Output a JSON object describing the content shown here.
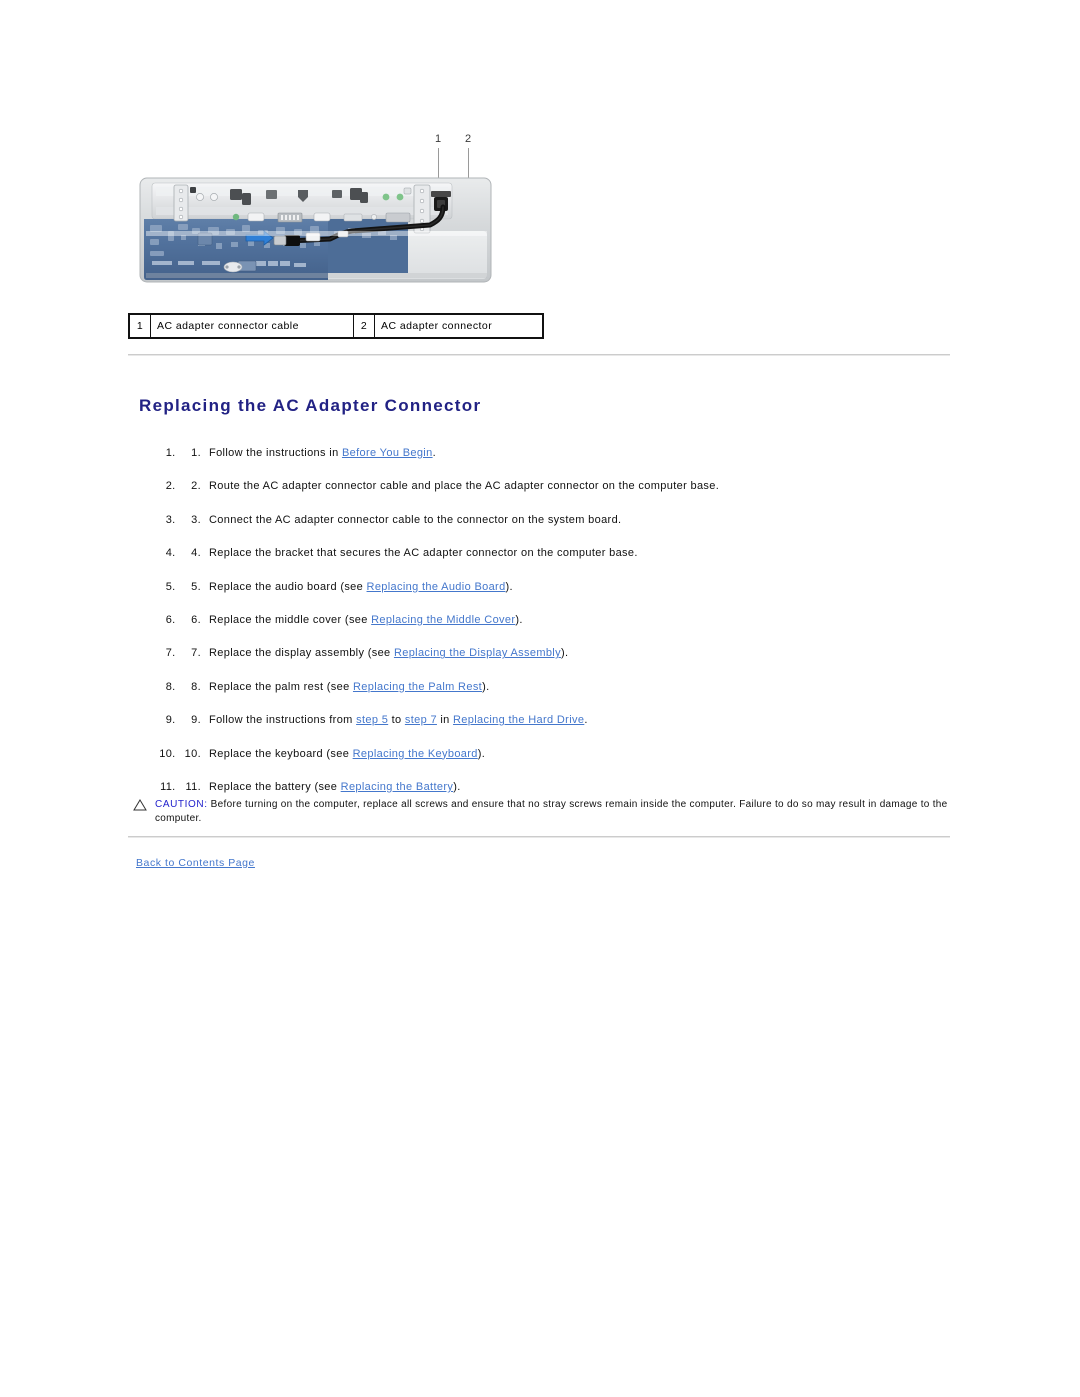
{
  "figure": {
    "alt": "Laptop computer base with system board and AC adapter connector cable routing",
    "callouts": [
      {
        "num": "1",
        "label": "AC adapter connector cable"
      },
      {
        "num": "2",
        "label": "AC adapter connector"
      }
    ]
  },
  "legend": {
    "rows": [
      {
        "num": "1",
        "label": "AC adapter connector cable"
      },
      {
        "num": "2",
        "label": "AC adapter connector"
      }
    ]
  },
  "heading": "Replacing the AC Adapter Connector",
  "steps": [
    {
      "marker": "1.",
      "parts": [
        {
          "t": "text",
          "v": "Follow the instructions in "
        },
        {
          "t": "link",
          "v": "Before You Begin"
        },
        {
          "t": "text",
          "v": "."
        }
      ]
    },
    {
      "marker": "2.",
      "parts": [
        {
          "t": "text",
          "v": "Route the AC adapter connector cable and place the AC adapter connector on the computer base."
        }
      ]
    },
    {
      "marker": "3.",
      "parts": [
        {
          "t": "text",
          "v": "Connect the AC adapter connector cable to the connector on the system board."
        }
      ]
    },
    {
      "marker": "4.",
      "parts": [
        {
          "t": "text",
          "v": "Replace the bracket that secures the AC adapter connector on the computer base."
        }
      ]
    },
    {
      "marker": "5.",
      "parts": [
        {
          "t": "text",
          "v": "Replace the audio board (see "
        },
        {
          "t": "link",
          "v": "Replacing the Audio Board"
        },
        {
          "t": "text",
          "v": ")."
        }
      ]
    },
    {
      "marker": "6.",
      "parts": [
        {
          "t": "text",
          "v": "Replace the middle cover (see "
        },
        {
          "t": "link",
          "v": "Replacing the Middle Cover"
        },
        {
          "t": "text",
          "v": ")."
        }
      ]
    },
    {
      "marker": "7.",
      "parts": [
        {
          "t": "text",
          "v": "Replace the display assembly (see "
        },
        {
          "t": "link",
          "v": "Replacing the Display Assembly"
        },
        {
          "t": "text",
          "v": ")."
        }
      ]
    },
    {
      "marker": "8.",
      "parts": [
        {
          "t": "text",
          "v": "Replace the palm rest (see "
        },
        {
          "t": "link",
          "v": "Replacing the Palm Rest"
        },
        {
          "t": "text",
          "v": ")."
        }
      ]
    },
    {
      "marker": "9.",
      "parts": [
        {
          "t": "text",
          "v": "Follow the instructions from "
        },
        {
          "t": "link",
          "v": "step 5"
        },
        {
          "t": "text",
          "v": " to "
        },
        {
          "t": "link",
          "v": "step 7"
        },
        {
          "t": "text",
          "v": " in "
        },
        {
          "t": "link",
          "v": "Replacing the Hard Drive"
        },
        {
          "t": "text",
          "v": "."
        }
      ]
    },
    {
      "marker": "10.",
      "parts": [
        {
          "t": "text",
          "v": "Replace the keyboard (see "
        },
        {
          "t": "link",
          "v": "Replacing the Keyboard"
        },
        {
          "t": "text",
          "v": ")."
        }
      ]
    },
    {
      "marker": "11.",
      "parts": [
        {
          "t": "text",
          "v": "Replace the battery (see "
        },
        {
          "t": "link",
          "v": "Replacing the Battery"
        },
        {
          "t": "text",
          "v": ")."
        }
      ]
    }
  ],
  "caution": {
    "icon": "warning-triangle-icon",
    "label": "CAUTION:",
    "text": " Before turning on the computer, replace all screws and ensure that no stray screws remain inside the computer. Failure to do so may result in damage to the computer."
  },
  "footer": {
    "back_link": "Back to Contents Page"
  },
  "colors": {
    "heading": "#222284",
    "link": "#4477cc",
    "caution_label": "#2222cc",
    "rule": "#cccccc",
    "text": "#111111"
  }
}
